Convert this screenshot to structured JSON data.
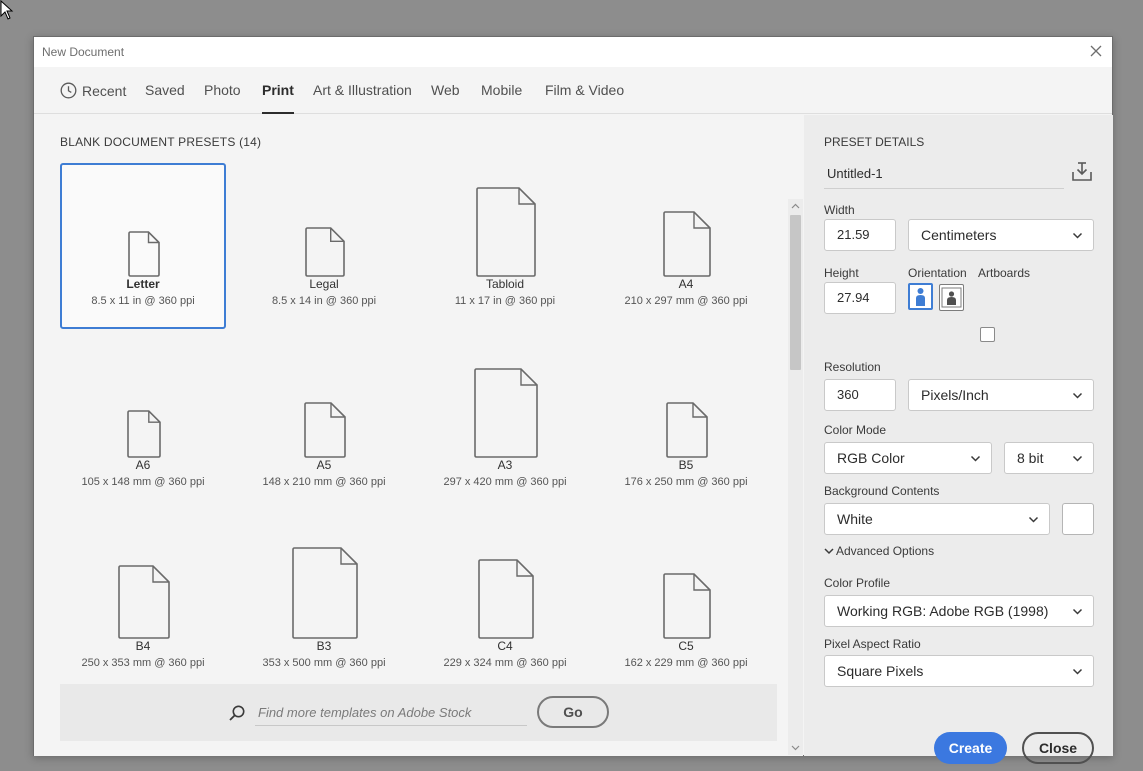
{
  "dialog": {
    "title": "New Document"
  },
  "tabs": [
    {
      "label": "Recent",
      "icon": "clock-icon"
    },
    {
      "label": "Saved"
    },
    {
      "label": "Photo"
    },
    {
      "label": "Print",
      "active": true
    },
    {
      "label": "Art & Illustration"
    },
    {
      "label": "Web"
    },
    {
      "label": "Mobile"
    },
    {
      "label": "Film & Video"
    }
  ],
  "presets": {
    "heading": "BLANK DOCUMENT PRESETS  (14)",
    "items": [
      {
        "name": "Letter",
        "size": "8.5 x 11 in @ 360 ppi",
        "selected": true
      },
      {
        "name": "Legal",
        "size": "8.5 x 14 in @ 360 ppi"
      },
      {
        "name": "Tabloid",
        "size": "11 x 17 in @ 360 ppi"
      },
      {
        "name": "A4",
        "size": "210 x 297 mm @ 360 ppi"
      },
      {
        "name": "A6",
        "size": "105 x 148 mm @ 360 ppi"
      },
      {
        "name": "A5",
        "size": "148 x 210 mm @ 360 ppi"
      },
      {
        "name": "A3",
        "size": "297 x 420 mm @ 360 ppi"
      },
      {
        "name": "B5",
        "size": "176 x 250 mm @ 360 ppi"
      },
      {
        "name": "B4",
        "size": "250 x 353 mm @ 360 ppi"
      },
      {
        "name": "B3",
        "size": "353 x 500 mm @ 360 ppi"
      },
      {
        "name": "C4",
        "size": "229 x 324 mm @ 360 ppi"
      },
      {
        "name": "C5",
        "size": "162 x 229 mm @ 360 ppi"
      }
    ]
  },
  "search": {
    "placeholder": "Find more templates on Adobe Stock",
    "button": "Go"
  },
  "details": {
    "heading": "PRESET DETAILS",
    "doc_name": "Untitled-1",
    "width_label": "Width",
    "width_value": "21.59",
    "width_unit": "Centimeters",
    "height_label": "Height",
    "height_value": "27.94",
    "orientation_label": "Orientation",
    "artboards_label": "Artboards",
    "resolution_label": "Resolution",
    "resolution_value": "360",
    "resolution_unit": "Pixels/Inch",
    "color_mode_label": "Color Mode",
    "color_mode": "RGB Color",
    "bit_depth": "8 bit",
    "background_label": "Background Contents",
    "background": "White",
    "advanced_label": "Advanced Options",
    "profile_label": "Color Profile",
    "profile": "Working RGB: Adobe RGB (1998)",
    "aspect_label": "Pixel Aspect Ratio",
    "aspect": "Square Pixels"
  },
  "buttons": {
    "create": "Create",
    "close": "Close"
  },
  "colors": {
    "accent": "#3b78e0",
    "selection": "#3e7dd4"
  }
}
